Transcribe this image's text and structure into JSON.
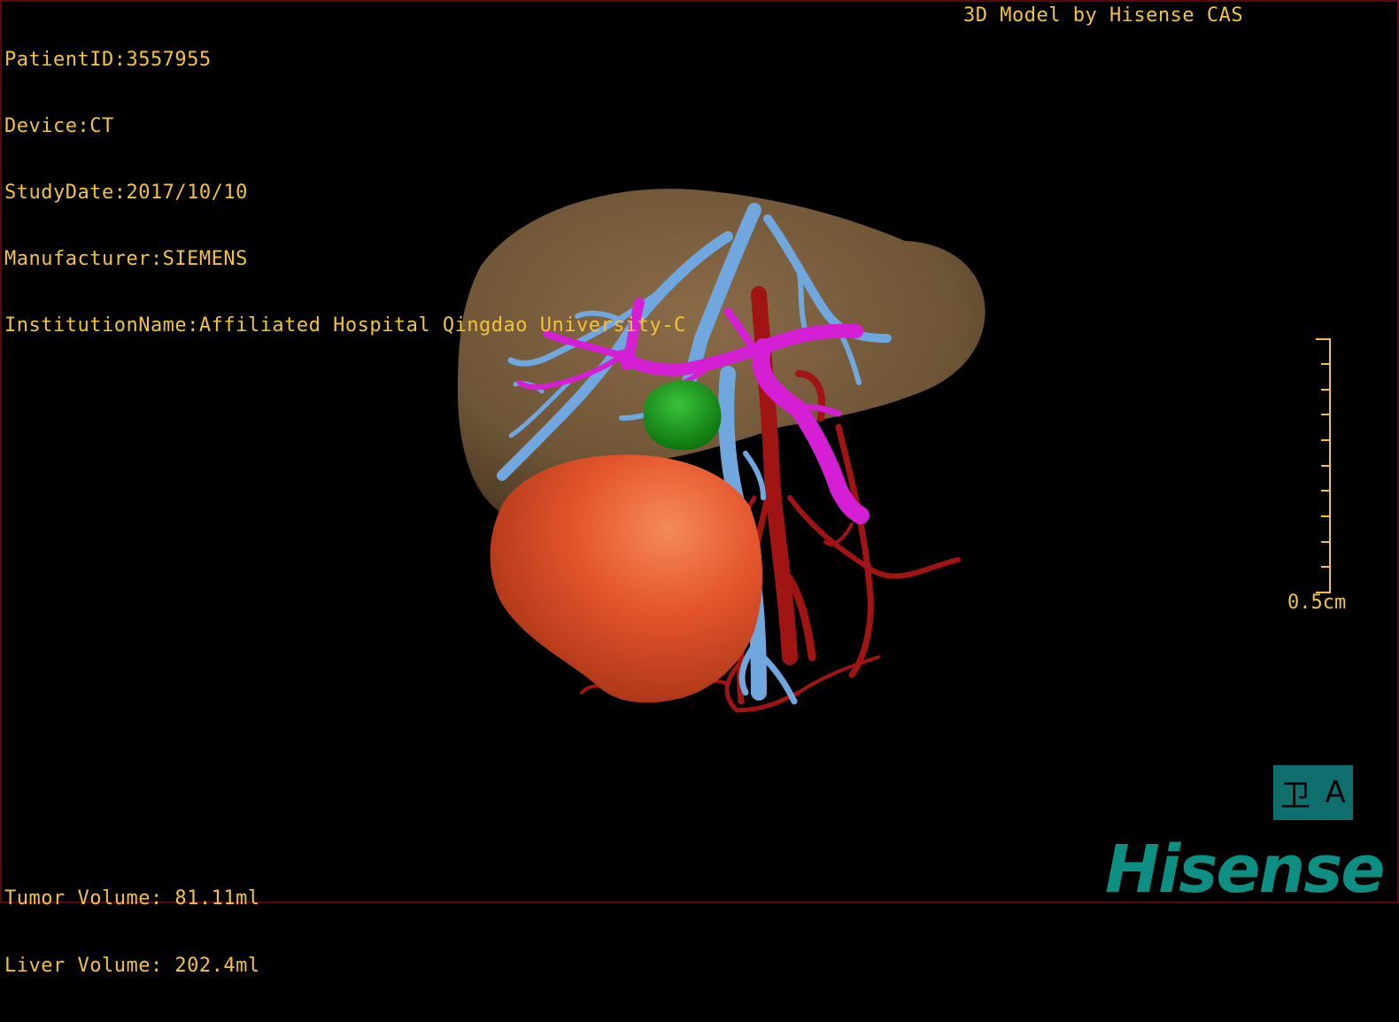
{
  "patient_info": {
    "patient_id": "PatientID:3557955",
    "device": "Device:CT",
    "study_date": "StudyDate:2017/10/10",
    "manufacturer": "Manufacturer:SIEMENS",
    "institution": "InstitutionName:Affiliated Hospital Qingdao University-C"
  },
  "model_credit": "3D Model by Hisense CAS",
  "scale": {
    "label": "0.5cm"
  },
  "volumes": {
    "tumor": "Tumor Volume: 81.11ml",
    "liver": "Liver Volume: 202.4ml"
  },
  "view_toggle": {
    "left_glyph": "卫",
    "right_glyph": "A"
  },
  "brand": "Hisense",
  "colors": {
    "overlay_text": "#f2c43a",
    "liver": "#7a5f3f",
    "tumor": "#e0502a",
    "hepatic_vein": "#6fa7de",
    "portal_vein": "#d41fd4",
    "artery": "#a01414",
    "gallbladder": "#1a9a1a",
    "brand": "#0e8f84"
  }
}
